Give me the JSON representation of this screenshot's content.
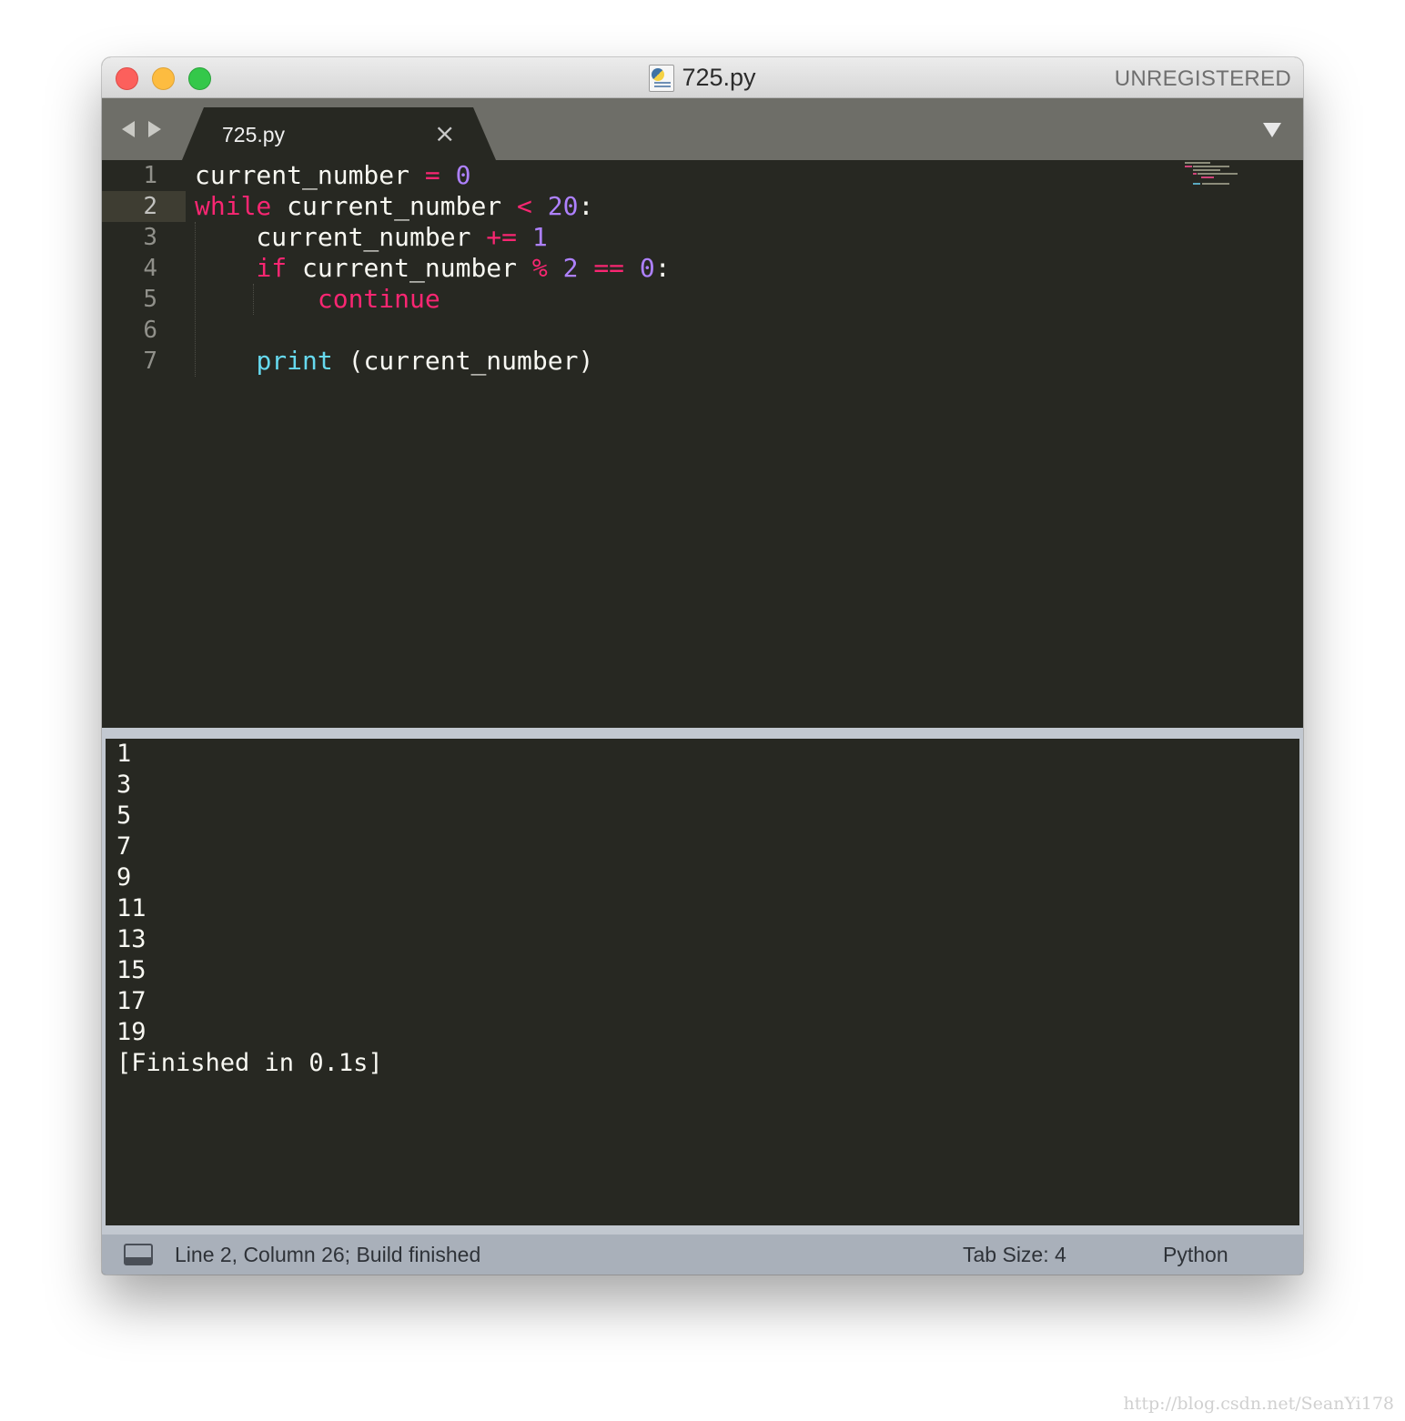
{
  "window": {
    "title": "725.py",
    "license_status": "UNREGISTERED"
  },
  "tab": {
    "label": "725.py",
    "close_glyph": "×"
  },
  "editor": {
    "line_numbers": [
      "1",
      "2",
      "3",
      "4",
      "5",
      "6",
      "7"
    ],
    "active_line": "2",
    "code_lines": [
      "current_number = 0",
      "while current_number < 20:",
      "    current_number += 1",
      "    if current_number % 2 == 0:",
      "        continue",
      "",
      "    print (current_number)"
    ]
  },
  "output": {
    "lines": [
      "1",
      "3",
      "5",
      "7",
      "9",
      "11",
      "13",
      "15",
      "17",
      "19",
      "[Finished in 0.1s]"
    ]
  },
  "statusbar": {
    "position": "Line 2, Column 26; Build finished",
    "tab_size": "Tab Size: 4",
    "syntax": "Python"
  },
  "watermark": "http://blog.csdn.net/SeanYi178",
  "icons": [
    "close-dot",
    "minimize-dot",
    "zoom-dot",
    "python-file-icon",
    "nav-left-icon",
    "nav-right-icon",
    "tab-close-icon",
    "tab-dropdown-icon",
    "output-panel-icon"
  ],
  "colors": {
    "editor_bg": "#272822",
    "keyword": "#f92672",
    "number": "#ae81ff",
    "function": "#66d9ef",
    "text": "#f8f8f2"
  }
}
